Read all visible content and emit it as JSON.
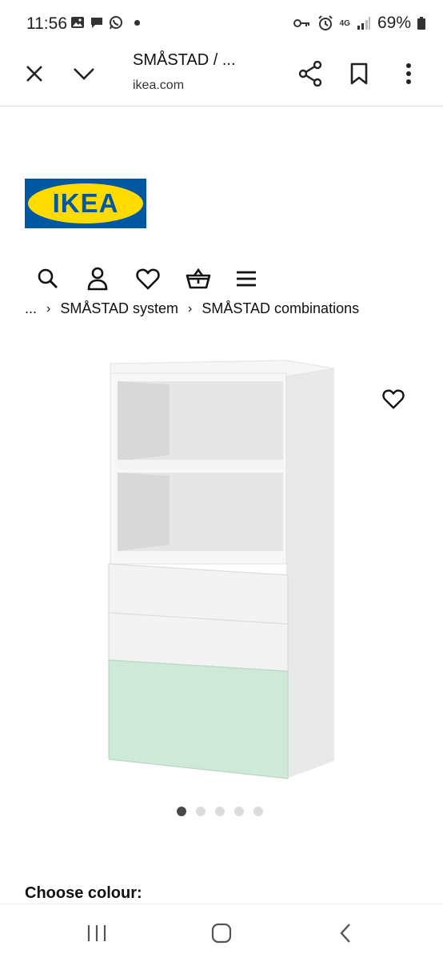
{
  "status_bar": {
    "time": "11:56",
    "network": "4G",
    "battery": "69%"
  },
  "browser": {
    "title": "SMÅSTAD / ...",
    "url": "ikea.com"
  },
  "logo": {
    "text": "IKEA",
    "colors": {
      "blue": "#0058a3",
      "yellow": "#ffdb00"
    }
  },
  "nav_icons": [
    "search-icon",
    "account-icon",
    "heart-icon",
    "basket-icon",
    "menu-icon"
  ],
  "breadcrumb": {
    "ellipsis": "...",
    "items": [
      "SMÅSTAD system",
      "SMÅSTAD combinations"
    ],
    "separator": "›"
  },
  "gallery": {
    "image_count": 5,
    "active_index": 0
  },
  "section": {
    "choose_colour": "Choose colour:"
  },
  "colors": {
    "accent_mint": "#cfe9d8",
    "cabinet_white": "#f4f4f4"
  }
}
